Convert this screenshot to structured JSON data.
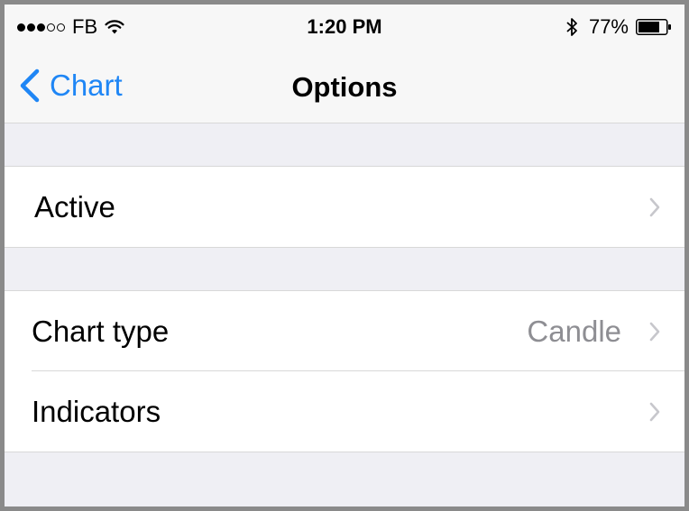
{
  "status_bar": {
    "carrier": "FB",
    "time": "1:20 PM",
    "battery": "77%",
    "signal_bars_filled": 3,
    "signal_bars_total": 5,
    "battery_fraction": 0.77,
    "icons": [
      "wifi-icon",
      "bluetooth-icon",
      "battery-icon"
    ]
  },
  "nav_bar": {
    "back_label": "Chart",
    "title": "Options",
    "accent_color": "#1f86f5"
  },
  "groups": [
    {
      "rows": [
        {
          "label": "Active",
          "value": ""
        }
      ]
    },
    {
      "rows": [
        {
          "label": "Chart type",
          "value": "Candle"
        },
        {
          "label": "Indicators",
          "value": ""
        }
      ]
    }
  ]
}
